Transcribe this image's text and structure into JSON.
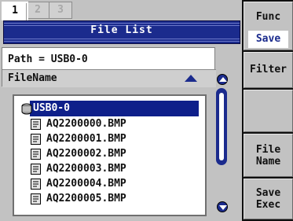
{
  "tabs": [
    {
      "label": "1",
      "active": true
    },
    {
      "label": "2",
      "active": false
    },
    {
      "label": "3",
      "active": false
    }
  ],
  "title": "File List",
  "path": "Path = USB0-0",
  "list_header": {
    "column": "FileName",
    "sort_icon": "triangle-up-icon"
  },
  "tree": {
    "root": {
      "label": "USB0-0",
      "icon": "drive-icon",
      "selected": true
    },
    "files": [
      {
        "name": "AQ2200000.BMP",
        "icon": "document-icon"
      },
      {
        "name": "AQ2200001.BMP",
        "icon": "document-icon"
      },
      {
        "name": "AQ2200002.BMP",
        "icon": "document-icon"
      },
      {
        "name": "AQ2200003.BMP",
        "icon": "document-icon"
      },
      {
        "name": "AQ2200004.BMP",
        "icon": "document-icon"
      },
      {
        "name": "AQ2200005.BMP",
        "icon": "document-icon"
      }
    ]
  },
  "softkeys": {
    "func": {
      "label": "Func",
      "value": "Save"
    },
    "filter": "Filter",
    "blank": "",
    "file_name": {
      "line1": "File",
      "line2": "Name"
    },
    "save_exec": {
      "line1": "Save",
      "line2": "Exec"
    }
  },
  "colors": {
    "accent": "#1b2b8d",
    "background": "#c2c2c2",
    "softkey_panel": "#0f0f0f"
  }
}
